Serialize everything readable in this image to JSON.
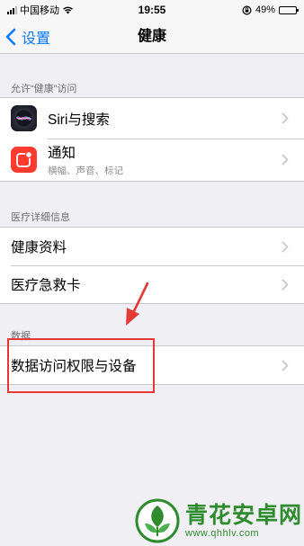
{
  "status_bar": {
    "carrier": "中国移动",
    "time": "19:55",
    "battery_percent": "49%",
    "battery_level": 0.49
  },
  "nav": {
    "back_label": "设置",
    "title": "健康"
  },
  "sections": [
    {
      "header": "允许“健康”访问",
      "items": [
        {
          "title": "Siri与搜索",
          "icon": "siri-icon"
        },
        {
          "title": "通知",
          "subtitle": "横幅、声音、标记",
          "icon": "notifications-icon"
        }
      ]
    },
    {
      "header": "医疗详细信息",
      "items": [
        {
          "title": "健康资料"
        },
        {
          "title": "医疗急救卡"
        }
      ]
    },
    {
      "header": "数据",
      "items": [
        {
          "title": "数据访问权限与设备"
        }
      ]
    }
  ],
  "watermark": {
    "title": "青花安卓网",
    "url": "www.qhhlv.com"
  },
  "colors": {
    "accent": "#0a7aff",
    "background": "#efeff4",
    "annotation": "#e53935",
    "watermark": "#2e8b2e"
  }
}
